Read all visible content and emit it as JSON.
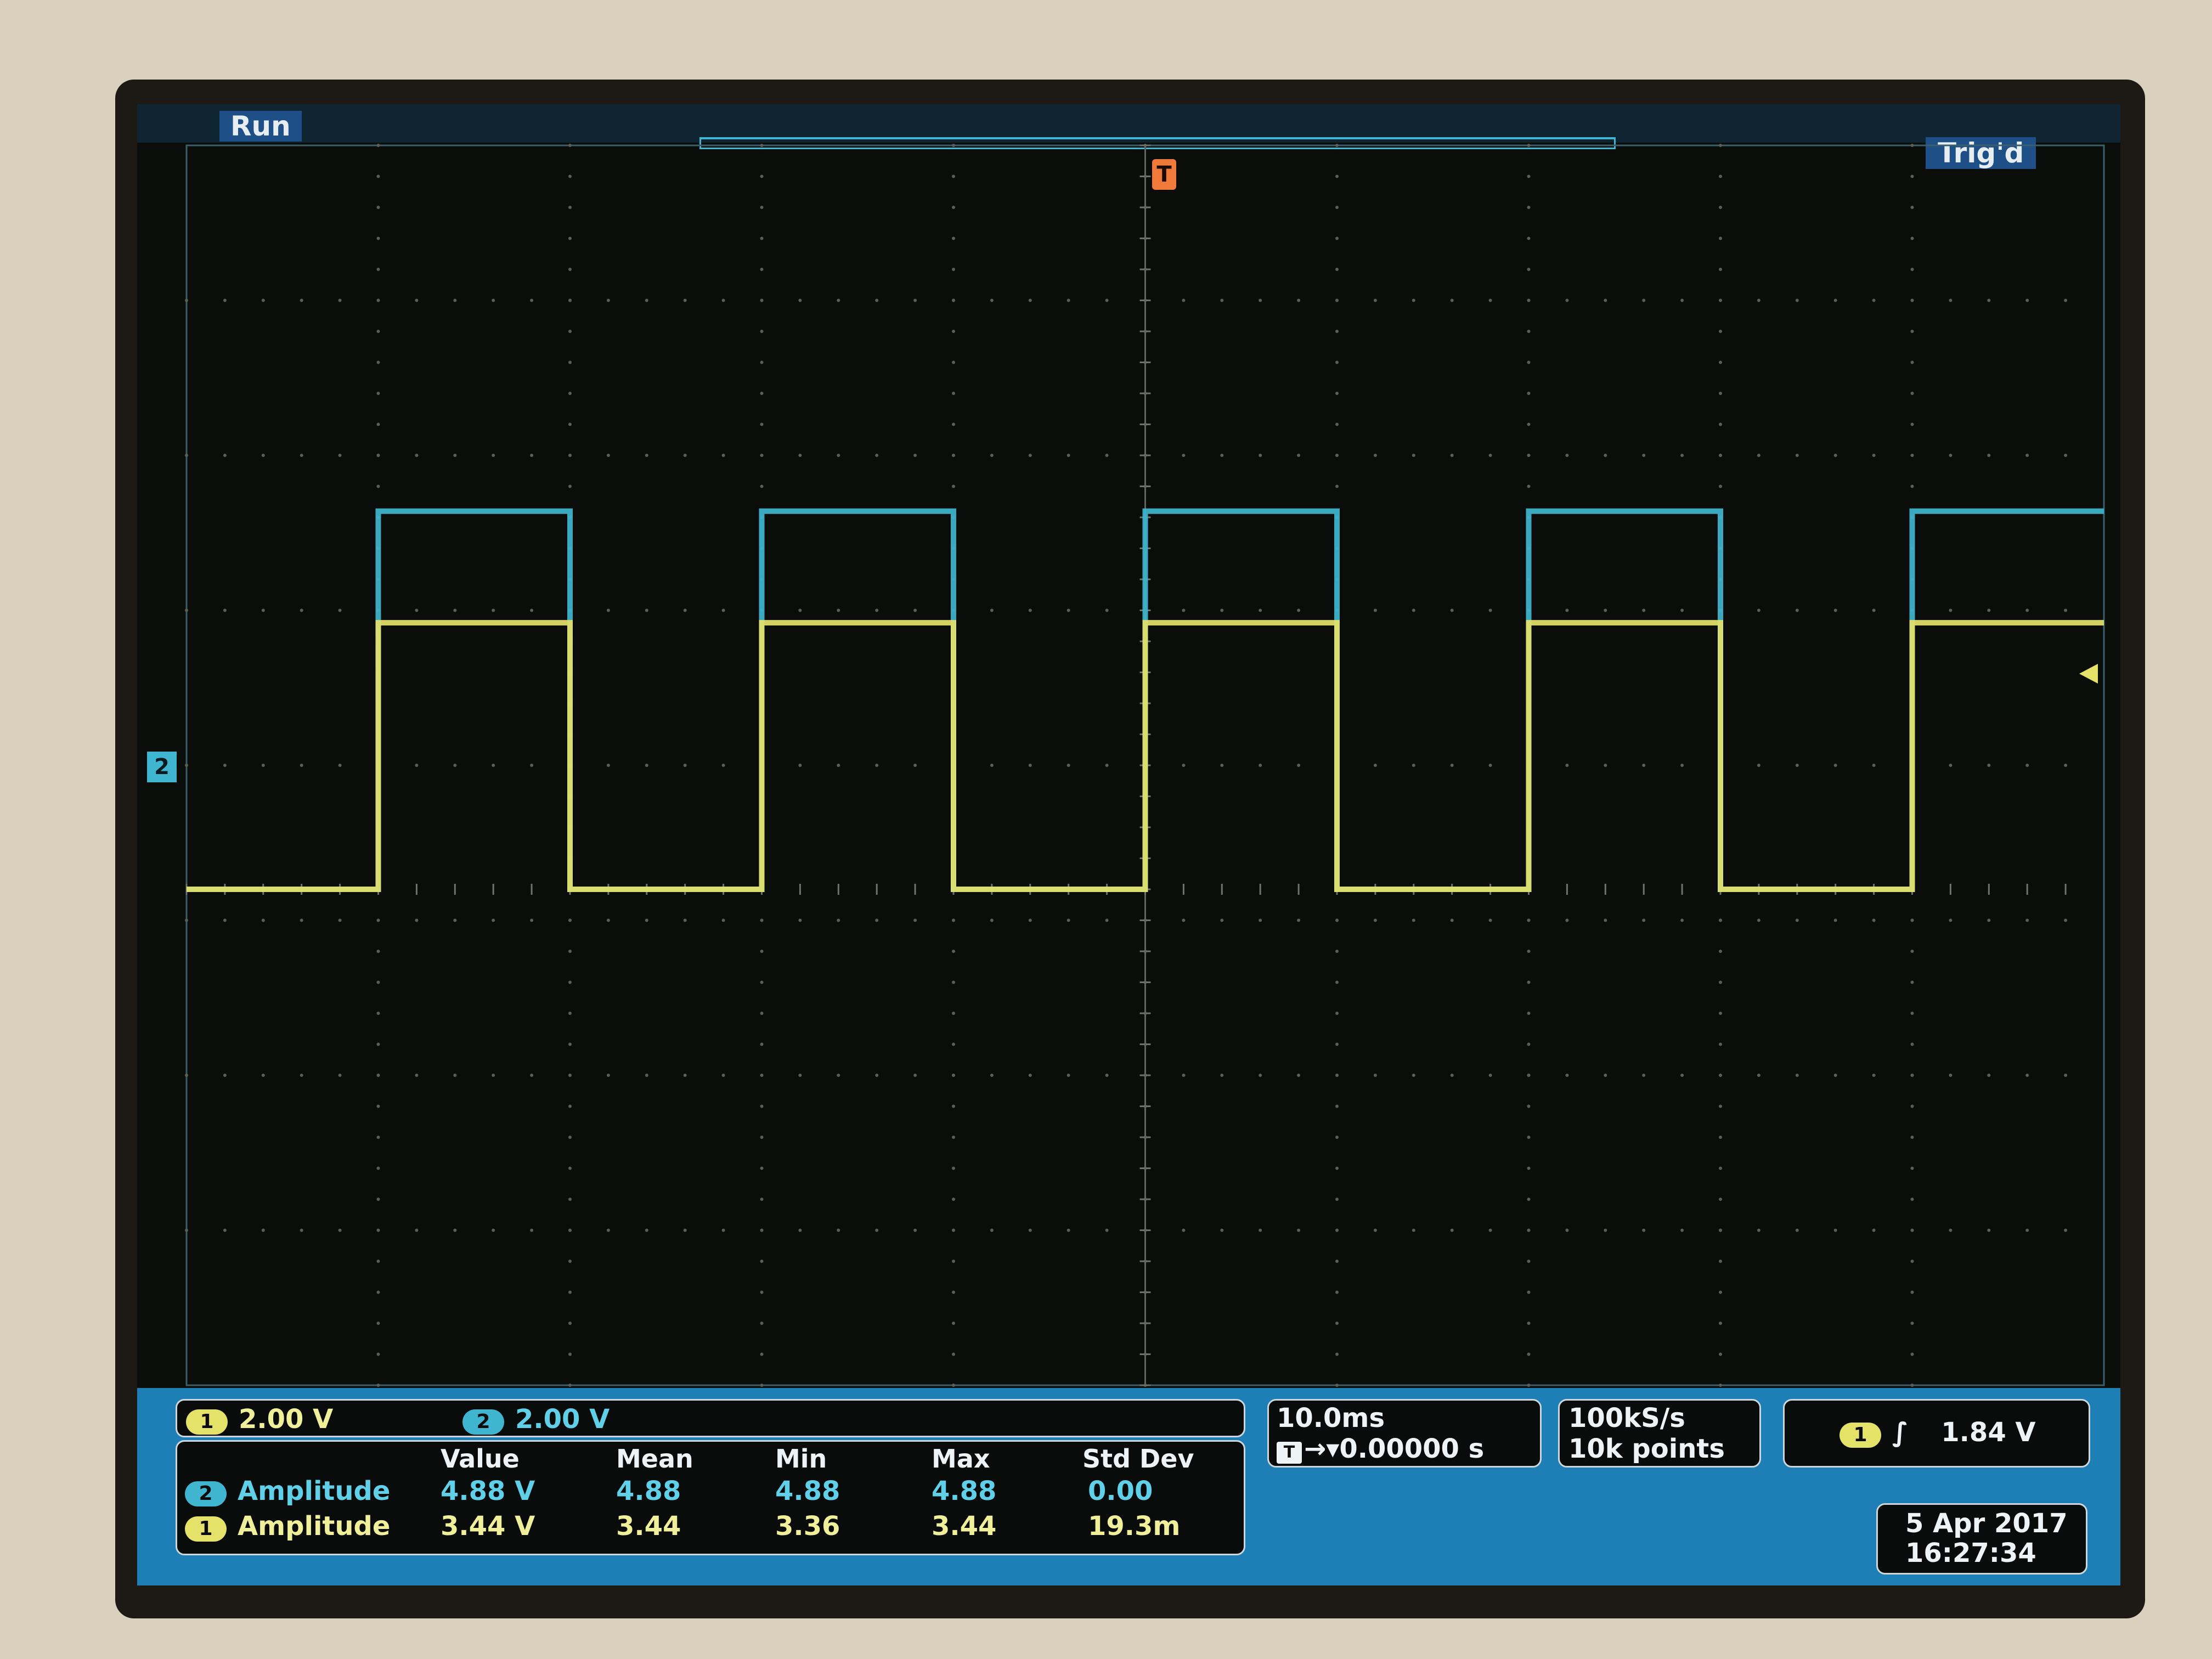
{
  "status": {
    "acquisition": "Run",
    "trigger_state": "Trig'd"
  },
  "markers": {
    "trigger_position": "T",
    "channel2_ground": "2"
  },
  "channels": {
    "ch1": {
      "badge": "1",
      "scale": "2.00 V",
      "color": "#e5e26a"
    },
    "ch2": {
      "badge": "2",
      "scale": "2.00 V",
      "color": "#3fb5cf"
    }
  },
  "measurements": {
    "headers": [
      "Value",
      "Mean",
      "Min",
      "Max",
      "Std Dev"
    ],
    "rows": [
      {
        "badge": "2",
        "label": "Amplitude",
        "value": "4.88 V",
        "mean": "4.88",
        "min": "4.88",
        "max": "4.88",
        "std_dev": "0.00"
      },
      {
        "badge": "1",
        "label": "Amplitude",
        "value": "3.44 V",
        "mean": "3.44",
        "min": "3.36",
        "max": "3.44",
        "std_dev": "19.3m"
      }
    ]
  },
  "timebase": {
    "per_div": "10.0ms",
    "delay": "0.00000 s"
  },
  "acquisition": {
    "sample_rate": "100kS/s",
    "record_length": "10k points"
  },
  "trigger": {
    "source_badge": "1",
    "slope_symbol": "∫",
    "level": "1.84 V"
  },
  "datetime": {
    "date": "5 Apr  2017",
    "time": "16:27:34"
  },
  "chart_data": {
    "type": "line",
    "title": "",
    "xlabel": "",
    "ylabel": "",
    "x_divisions": 10,
    "y_divisions": 8,
    "x_per_div": "10.0ms",
    "y_per_div": "2.00 V",
    "grid": true,
    "series": [
      {
        "name": "",
        "color": "#3fb5cf",
        "x_divisions": [
          0,
          1,
          1,
          2,
          2,
          3,
          3,
          4,
          4,
          5,
          5,
          6,
          6,
          7,
          7,
          8,
          8,
          9,
          9,
          10
        ],
        "y_volts": [
          0,
          0,
          4.88,
          4.88,
          0,
          0,
          4.88,
          4.88,
          0,
          0,
          4.88,
          4.88,
          0,
          0,
          4.88,
          4.88,
          0,
          0,
          4.88,
          4.88
        ]
      },
      {
        "name": "",
        "color": "#e5e26a",
        "x_divisions": [
          0,
          1,
          1,
          2,
          2,
          3,
          3,
          4,
          4,
          5,
          5,
          6,
          6,
          7,
          7,
          8,
          8,
          9,
          9,
          10
        ],
        "y_volts": [
          0,
          0,
          3.44,
          3.44,
          0,
          0,
          3.44,
          3.44,
          0,
          0,
          3.44,
          3.44,
          0,
          0,
          3.44,
          3.44,
          0,
          0,
          3.44,
          3.44
        ]
      }
    ]
  }
}
